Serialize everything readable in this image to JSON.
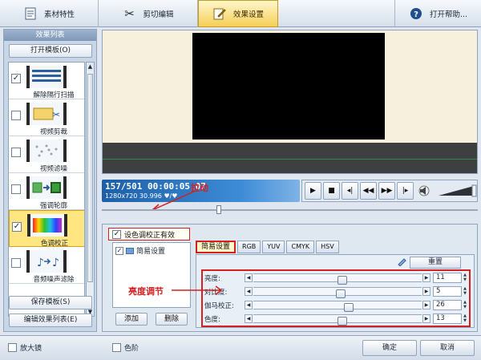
{
  "toolbar": {
    "tabs": [
      {
        "label": "素材特性",
        "icon": "document-icon"
      },
      {
        "label": "剪切编辑",
        "icon": "scissors-icon"
      },
      {
        "label": "效果设置",
        "icon": "edit-icon"
      }
    ],
    "help": {
      "label": "打开帮助...",
      "icon": "help-icon"
    }
  },
  "left_panel": {
    "title": "效果列表",
    "open_template": "打开模板(O)",
    "effects": [
      {
        "label": "解除隔行扫描",
        "checked": true,
        "selected": false
      },
      {
        "label": "视频剪裁",
        "checked": false,
        "selected": false
      },
      {
        "label": "视频滤噪",
        "checked": false,
        "selected": false
      },
      {
        "label": "强调轮廓",
        "checked": false,
        "selected": false
      },
      {
        "label": "色调校正",
        "checked": true,
        "selected": true
      },
      {
        "label": "音频噪声滤除",
        "checked": false,
        "selected": false
      }
    ],
    "save_template": "保存模板(S)",
    "edit_list": "编辑效果列表(E)"
  },
  "player": {
    "timecode": "157/501  00:00:05.07",
    "info": "1280x720 30.996 ♥/♥",
    "annotation": "拉动"
  },
  "color_settings": {
    "enable_label": "设色调校正有效",
    "enable_checked": true,
    "tree_item": "简易设置",
    "add_button": "添加",
    "delete_button": "删除",
    "tabs": [
      "简易设置",
      "RGB",
      "YUV",
      "CMYK",
      "HSV"
    ],
    "reset_button": "重置",
    "adjustments": [
      {
        "label": "亮度:",
        "value": "11",
        "level": 0.53
      },
      {
        "label": "对比度:",
        "value": "5",
        "level": 0.52
      },
      {
        "label": "伽马校正:",
        "value": "26",
        "level": 0.57
      },
      {
        "label": "色度:",
        "value": "13",
        "level": 0.53
      }
    ],
    "annotation": "亮度调节"
  },
  "bottom": {
    "magnifier": "放大镜",
    "levels": "色阶",
    "ok": "确定",
    "cancel": "取消"
  }
}
